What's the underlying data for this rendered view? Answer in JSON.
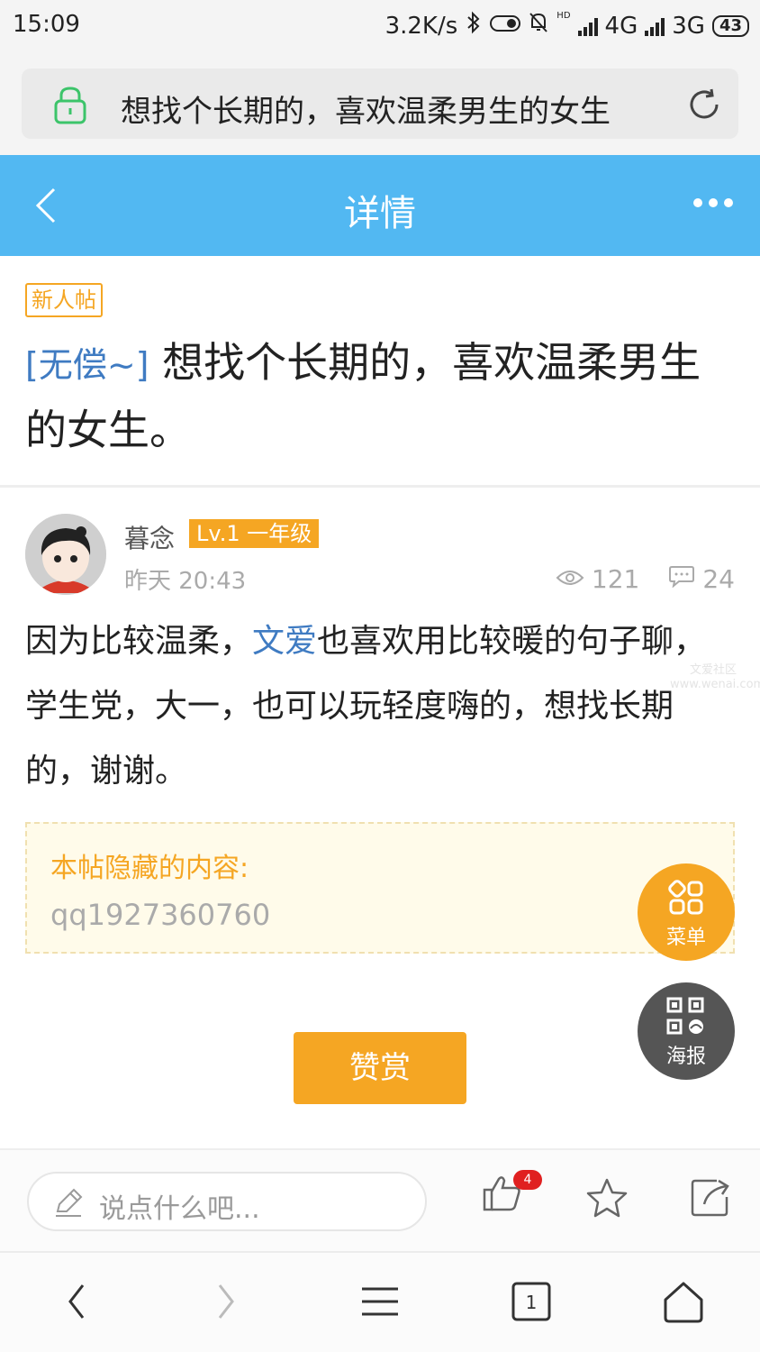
{
  "status_bar": {
    "time": "15:09",
    "net_speed": "3.2K/s",
    "hd_label": "HD",
    "network1": "4G",
    "network2": "3G",
    "battery": "43"
  },
  "address_bar": {
    "title": "想找个长期的，喜欢温柔男生的女生"
  },
  "header": {
    "title": "详情"
  },
  "post": {
    "new_tag": "新人帖",
    "category": "[无偿~]",
    "title": " 想找个长期的，喜欢温柔男生的女生。",
    "author": "暮念",
    "level": "Lv.1 一年级",
    "time": "昨天 20:43",
    "views": "121",
    "comments": "24",
    "content_part1": "因为比较温柔，",
    "content_link": "文爱",
    "content_part2": "也喜欢用比较暖的句子聊，学生党，大一，也可以玩轻度嗨的，想找长期的，谢谢。",
    "watermark_line1": "文爱社区",
    "watermark_line2": "www.wenai.com",
    "hidden_label": "本帖隐藏的内容:",
    "hidden_value": "qq1927360760",
    "reward_label": "赞赏"
  },
  "floating": {
    "menu_label": "菜单",
    "poster_label": "海报"
  },
  "comment_bar": {
    "placeholder": "说点什么吧...",
    "like_count": "4"
  },
  "browser_nav": {
    "tab_count": "1"
  },
  "colors": {
    "header_blue": "#52b8f2",
    "accent_orange": "#f5a623",
    "link_blue": "#3f7bc2",
    "badge_red": "#e02020"
  }
}
